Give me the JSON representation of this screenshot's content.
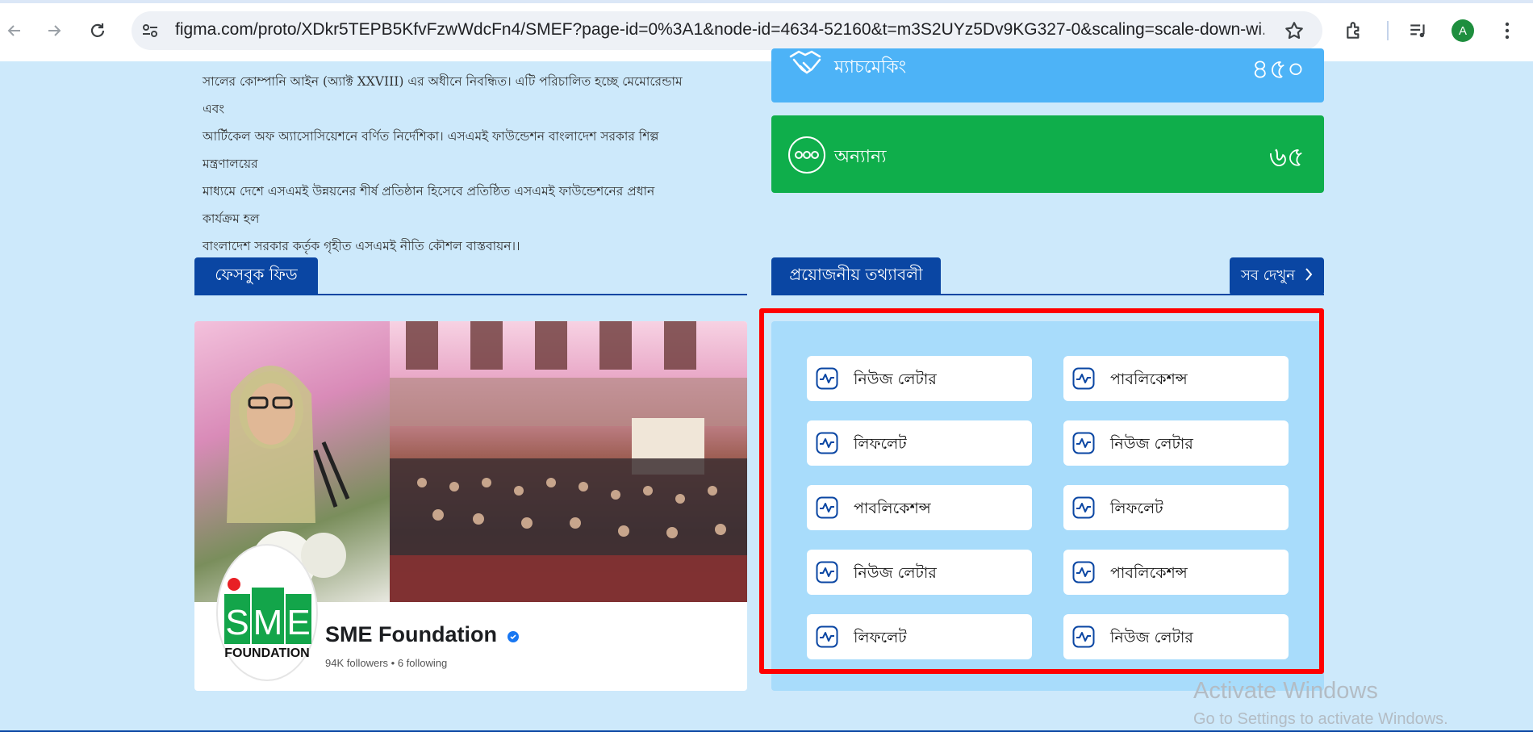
{
  "browser": {
    "url": "figma.com/proto/XDkr5TEPB5KfvFzwWdcFn4/SMEF?page-id=0%3A1&node-id=4634-52160&t=m3S2UYz5Dv9KG327-0&scaling=scale-down-wi...",
    "avatar_letter": "A",
    "icons": [
      "back-arrow-icon",
      "forward-arrow-icon",
      "reload-icon",
      "site-settings-icon",
      "bookmark-star-icon",
      "extensions-icon",
      "media-control-icon",
      "more-menu-icon"
    ]
  },
  "about": {
    "lines": [
      "সালের কোম্পানি আইন (অ্যাক্ট XXVIII) এর অধীনে নিবন্ধিত। এটি পরিচালিত হচ্ছে মেমোরেন্ডাম এবং",
      "আর্টিকেল অফ অ্যাসোসিয়েশনে বর্ণিত নির্দেশিকা। এসএমই ফাউন্ডেশন বাংলাদেশ সরকার শিল্প মন্ত্রণালয়ের",
      "মাধ্যমে দেশে এসএমই উন্নয়নের শীর্ষ প্রতিষ্ঠান হিসেবে প্রতিষ্ঠিত এসএমই ফাউন্ডেশনের প্রধান কার্যক্রম হল",
      "বাংলাদেশ সরকার কর্তৃক গৃহীত এসএমই নীতি কৌশল বাস্তবায়ন।।"
    ]
  },
  "stats": [
    {
      "label": "ম্যাচমেকিং",
      "value": "৪৫০",
      "icon": "handshake-icon",
      "color": "#4db3f7"
    },
    {
      "label": "অন্যান্য",
      "value": "৬৫",
      "icon": "more-dots-icon",
      "color": "#0fae4b"
    }
  ],
  "facebook": {
    "title": "ফেসবুক ফিড",
    "page_name": "SME Foundation",
    "meta": "94K followers • 6 following",
    "logo_text": {
      "s": "S",
      "m": "M",
      "e": "E",
      "foundation": "FOUNDATION"
    }
  },
  "info": {
    "title": "প্রয়োজনীয় তথ্যাবলী",
    "see_all": "সব দেখুন",
    "items": [
      "নিউজ লেটার",
      "পাবলিকেশন্স",
      "লিফলেট",
      "নিউজ লেটার",
      "পাবলিকেশন্স",
      "লিফলেট",
      "নিউজ লেটার",
      "পাবলিকেশন্স",
      "লিফলেট",
      "নিউজ লেটার"
    ]
  },
  "watermark": {
    "line1": "Activate Windows",
    "line2": "Go to Settings to activate Windows."
  },
  "colors": {
    "primary": "#0a46a3",
    "highlight": "#ff0000",
    "page_bg": "#cde9fb",
    "panel_bg": "#a8dcfb"
  }
}
